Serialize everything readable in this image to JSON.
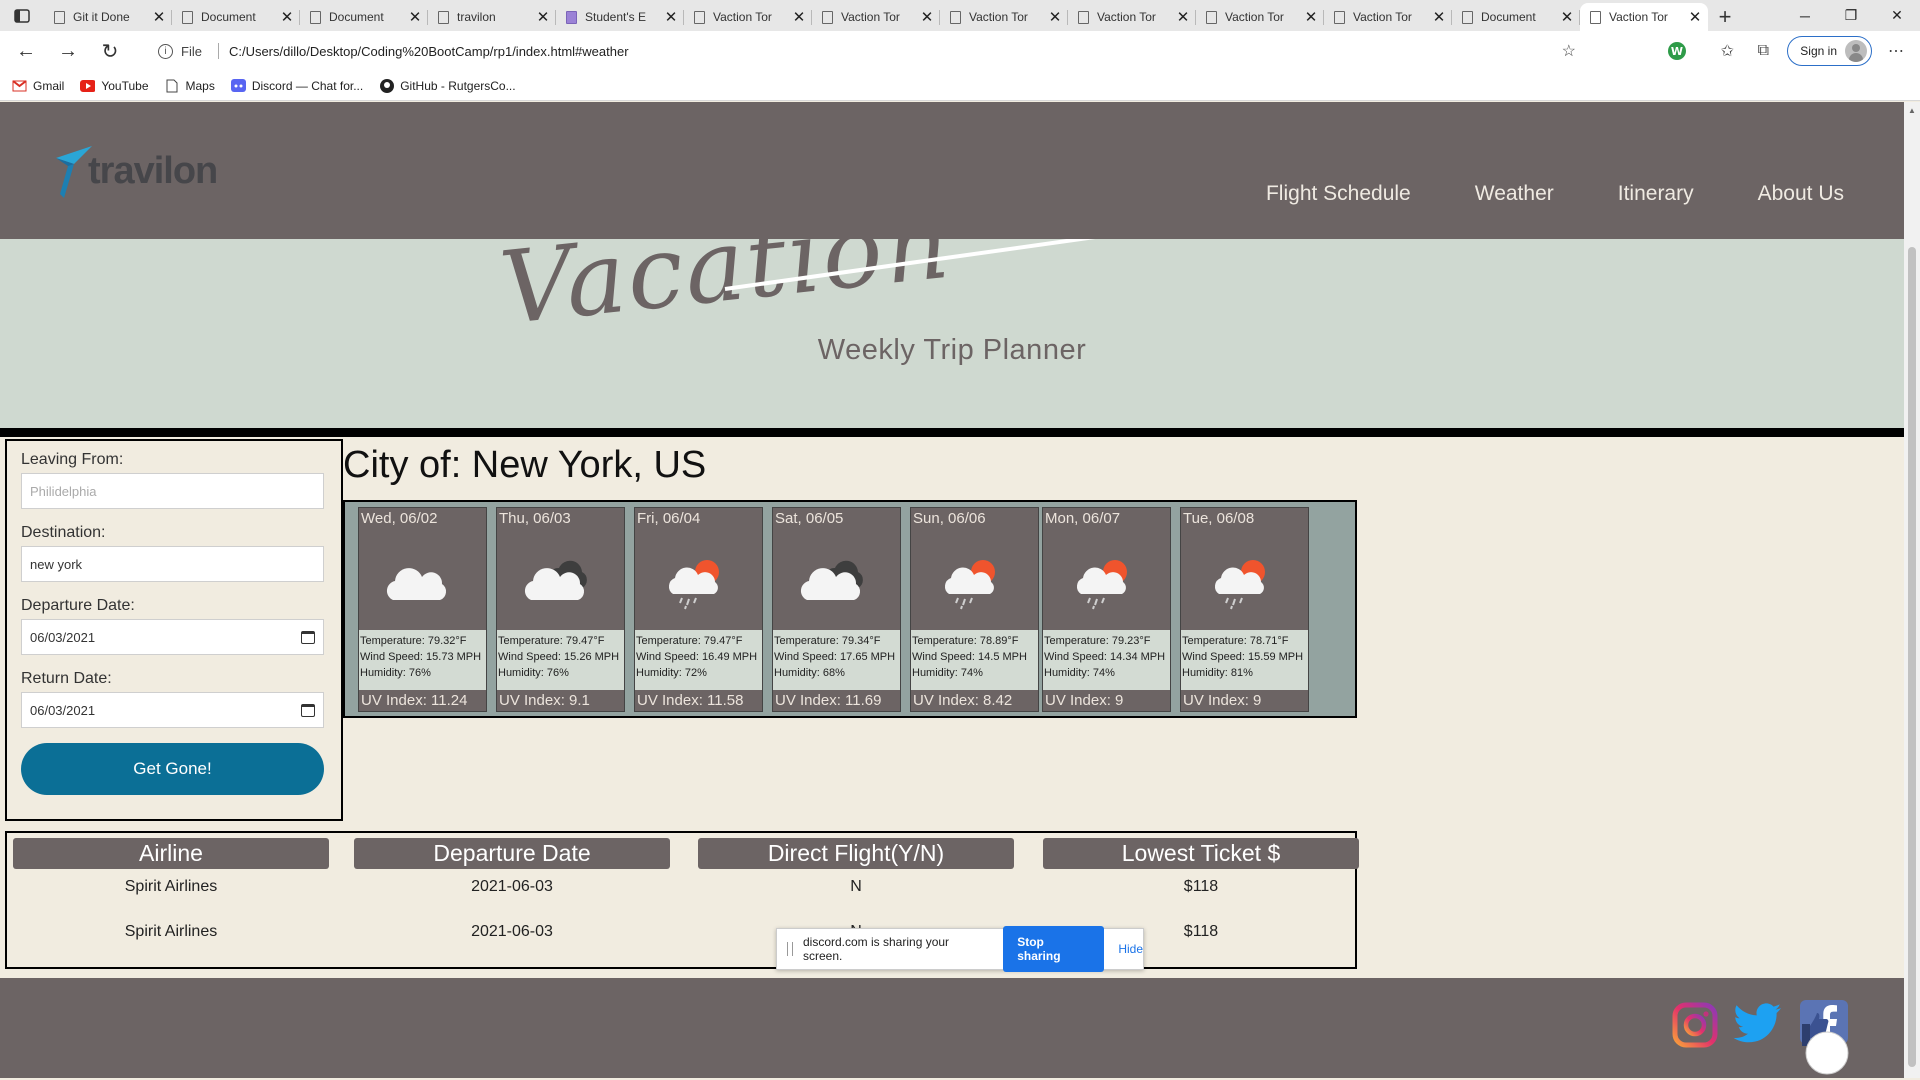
{
  "browser": {
    "tabs": [
      {
        "label": "Git it Done",
        "icon": "document-icon"
      },
      {
        "label": "Document",
        "icon": "document-icon"
      },
      {
        "label": "Document",
        "icon": "document-icon"
      },
      {
        "label": "travilon",
        "icon": "document-icon"
      },
      {
        "label": "Student's E",
        "icon": "form-icon"
      },
      {
        "label": "Vaction Tor",
        "icon": "document-icon"
      },
      {
        "label": "Vaction Tor",
        "icon": "document-icon"
      },
      {
        "label": "Vaction Tor",
        "icon": "document-icon"
      },
      {
        "label": "Vaction Tor",
        "icon": "document-icon"
      },
      {
        "label": "Vaction Tor",
        "icon": "document-icon"
      },
      {
        "label": "Vaction Tor",
        "icon": "document-icon"
      },
      {
        "label": "Document",
        "icon": "document-icon"
      },
      {
        "label": "Vaction Tor",
        "icon": "document-icon",
        "active": true
      }
    ],
    "url_scheme": "File",
    "url": "C:/Users/dillo/Desktop/Coding%20BootCamp/rp1/index.html#weather",
    "signin_label": "Sign in",
    "bookmarks": [
      {
        "label": "Gmail",
        "icon": "gmail-icon"
      },
      {
        "label": "YouTube",
        "icon": "youtube-icon"
      },
      {
        "label": "Maps",
        "icon": "document-icon"
      },
      {
        "label": "Discord — Chat for...",
        "icon": "discord-icon"
      },
      {
        "label": "GitHub - RutgersCo...",
        "icon": "github-icon"
      }
    ]
  },
  "header": {
    "logo_text": "travilon",
    "nav": [
      "Flight Schedule",
      "Weather",
      "Itinerary",
      "About Us"
    ],
    "subtitle": "Weekly Trip Planner",
    "colors": {
      "nav_bg": "#6c6464",
      "hero_bg": "#cfd9d0",
      "page_bg": "#f1ece0",
      "accent": "#0b6f96"
    }
  },
  "form": {
    "leaving_label": "Leaving From:",
    "leaving_placeholder": "Philidelphia",
    "destination_label": "Destination:",
    "destination_value": "new york",
    "departure_label": "Departure Date:",
    "departure_value": "06/03/2021",
    "return_label": "Return Date:",
    "return_value": "06/03/2021",
    "submit_label": "Get Gone!"
  },
  "weather": {
    "city_title": "City of: New York, US",
    "days": [
      {
        "date": "Wed, 06/02",
        "icon": "cloud-icon",
        "temp": "Temperature: 79.32°F",
        "wind": "Wind Speed: 15.73 MPH",
        "humidity": "Humidity: 76%",
        "uv": "UV Index: 11.24"
      },
      {
        "date": "Thu, 06/03",
        "icon": "dark-cloud-icon",
        "temp": "Temperature: 79.47°F",
        "wind": "Wind Speed: 15.26 MPH",
        "humidity": "Humidity: 76%",
        "uv": "UV Index: 9.1"
      },
      {
        "date": "Fri, 06/04",
        "icon": "sun-rain-icon",
        "temp": "Temperature: 79.47°F",
        "wind": "Wind Speed: 16.49 MPH",
        "humidity": "Humidity: 72%",
        "uv": "UV Index: 11.58"
      },
      {
        "date": "Sat, 06/05",
        "icon": "dark-cloud-icon",
        "temp": "Temperature: 79.34°F",
        "wind": "Wind Speed: 17.65 MPH",
        "humidity": "Humidity: 68%",
        "uv": "UV Index: 11.69"
      },
      {
        "date": "Sun, 06/06",
        "icon": "sun-rain-icon",
        "temp": "Temperature: 78.89°F",
        "wind": "Wind Speed: 14.5 MPH",
        "humidity": "Humidity: 74%",
        "uv": "UV Index: 8.42"
      },
      {
        "date": "Mon, 06/07",
        "icon": "sun-rain-icon",
        "temp": "Temperature: 79.23°F",
        "wind": "Wind Speed: 14.34 MPH",
        "humidity": "Humidity: 74%",
        "uv": "UV Index: 9"
      },
      {
        "date": "Tue, 06/08",
        "icon": "sun-rain-icon",
        "temp": "Temperature: 78.71°F",
        "wind": "Wind Speed: 15.59 MPH",
        "humidity": "Humidity: 81%",
        "uv": "UV Index: 9"
      }
    ]
  },
  "flights": {
    "headers": [
      "Airline",
      "Departure Date",
      "Direct Flight(Y/N)",
      "Lowest Ticket $"
    ],
    "rows": [
      [
        "Spirit Airlines",
        "2021-06-03",
        "N",
        "$118"
      ],
      [
        "Spirit Airlines",
        "2021-06-03",
        "N",
        "$118"
      ]
    ]
  },
  "footer": {
    "social_icons": [
      "instagram-icon",
      "twitter-icon",
      "facebook-icon"
    ]
  },
  "screen_share": {
    "message": "discord.com is sharing your screen.",
    "stop_label": "Stop sharing",
    "hide_label": "Hide"
  }
}
